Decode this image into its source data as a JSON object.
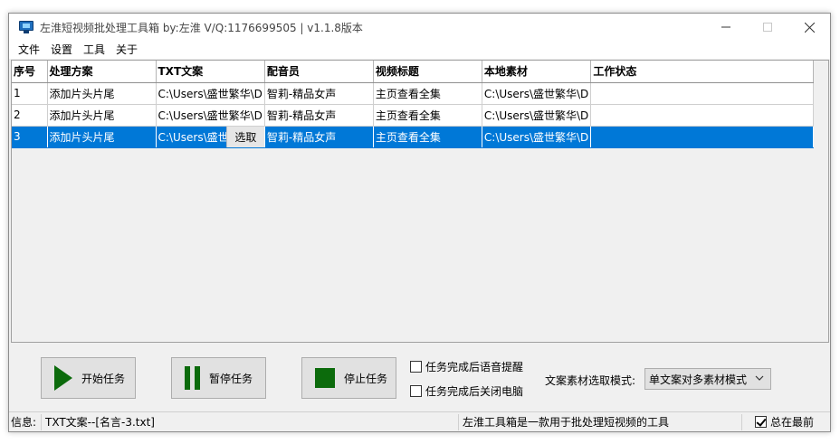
{
  "window": {
    "title": "左淮短视频批处理工具箱   by:左淮 V/Q:1176699505 | v1.1.8版本"
  },
  "menu": [
    "文件",
    "设置",
    "工具",
    "关于"
  ],
  "table": {
    "columns": [
      "序号",
      "处理方案",
      "TXT文案",
      "配音员",
      "视频标题",
      "本地素材",
      "工作状态"
    ],
    "rows": [
      [
        "1",
        "添加片头片尾",
        "C:\\Users\\盛世繁华\\D",
        "智莉-精品女声",
        "主页查看全集",
        "C:\\Users\\盛世繁华\\D",
        ""
      ],
      [
        "2",
        "添加片头片尾",
        "C:\\Users\\盛世繁华\\D",
        "智莉-精品女声",
        "主页查看全集",
        "C:\\Users\\盛世繁华\\D",
        ""
      ],
      [
        "3",
        "添加片头片尾",
        "C:\\Users\\盛世",
        "智莉-精品女声",
        "主页查看全集",
        "C:\\Users\\盛世繁华\\D",
        ""
      ]
    ],
    "selected_row": 2,
    "pick_button_label": "选取"
  },
  "controls": {
    "start_label": "开始任务",
    "pause_label": "暂停任务",
    "stop_label": "停止任务",
    "voice_reminder_label": "任务完成后语音提醒",
    "voice_reminder_checked": false,
    "shutdown_label": "任务完成后关闭电脑",
    "shutdown_checked": false,
    "mode_label": "文案素材选取模式:",
    "mode_value": "单文案对多素材模式"
  },
  "status": {
    "info_label": "信息:",
    "info_text": "TXT文案--[名言-3.txt]",
    "description": "左淮工具箱是一款用于批处理短视频的工具",
    "topmost_label": "总在最前",
    "topmost_checked": true
  },
  "colors": {
    "selection": "#0078d7",
    "icon_green": "#0c6b0c"
  }
}
